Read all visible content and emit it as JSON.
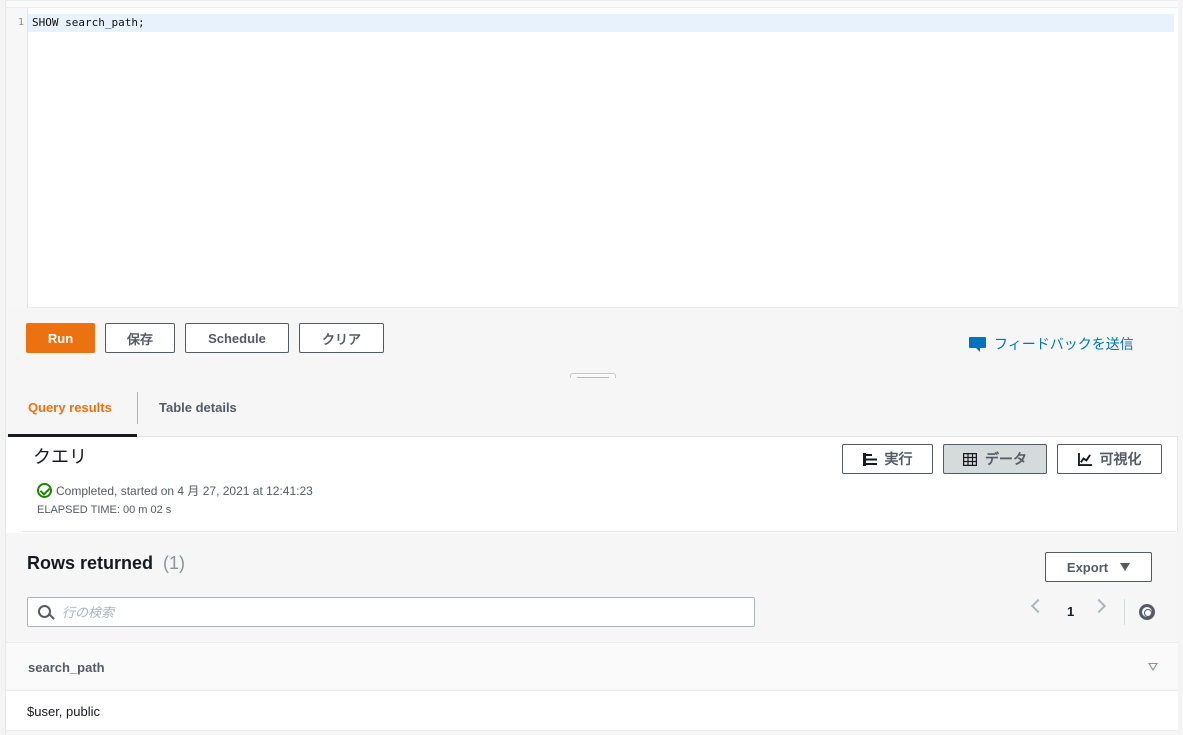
{
  "editor": {
    "line_number": "1",
    "code": "SHOW search_path;"
  },
  "toolbar": {
    "run_label": "Run",
    "save_label": "保存",
    "schedule_label": "Schedule",
    "clear_label": "クリア",
    "feedback_label": "フィードバックを送信"
  },
  "tabs": [
    {
      "label": "Query results",
      "active": true
    },
    {
      "label": "Table details",
      "active": false
    }
  ],
  "query": {
    "title": "クエリ",
    "status": "Completed, started on 4 月 27, 2021 at 12:41:23",
    "elapsed": "ELAPSED TIME: 00 m 02 s",
    "view_buttons": {
      "run": "実行",
      "data": "データ",
      "viz": "可視化"
    }
  },
  "results": {
    "title": "Rows returned",
    "count": "(1)",
    "export_label": "Export",
    "search_placeholder": "行の検索",
    "page": "1",
    "columns": [
      "search_path"
    ],
    "rows": [
      [
        "$user, public"
      ]
    ]
  },
  "colors": {
    "accent": "#ec7211",
    "link": "#0073bb",
    "success": "#1d8102"
  }
}
